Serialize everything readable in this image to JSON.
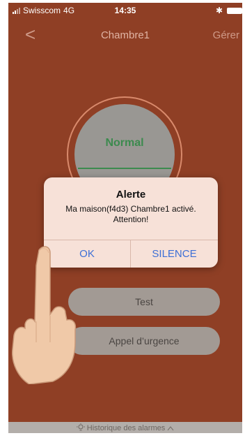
{
  "statusbar": {
    "carrier": "Swisscom",
    "network": "4G",
    "time": "14:35",
    "bluetooth": "✱"
  },
  "navbar": {
    "back_glyph": "<",
    "title": "Chambre1",
    "manage": "Gérer"
  },
  "status": {
    "label": "Normal",
    "label_color": "#3c8a4e"
  },
  "buttons": {
    "test": "Test",
    "emergency": "Appel d’urgence"
  },
  "bottom": {
    "history": "Historique des alarmes"
  },
  "alert": {
    "title": "Alerte",
    "message": "Ma maison(f4d3) Chambre1 activé. Attention!",
    "ok": "OK",
    "silence": "SILENCE"
  },
  "colors": {
    "background": "#8f3f25",
    "accent": "#3d6fd6"
  }
}
